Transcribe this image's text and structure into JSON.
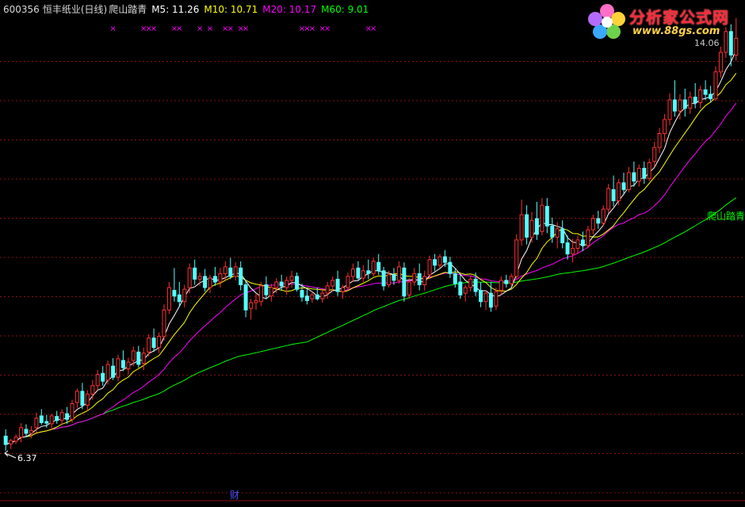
{
  "header": {
    "code": "600356",
    "name": "恒丰纸业(日线)",
    "indicator": "爬山踏青",
    "ma5": "M5: 11.26",
    "ma10": "M10: 10.71",
    "ma20": "M20: 10.17",
    "ma60": "M60: 9.01"
  },
  "watermark": {
    "title": "分析家公式网",
    "url": "www.88gs.com"
  },
  "colors": {
    "up": "#ff3030",
    "down": "#54ffff",
    "ma5": "#ffffff",
    "ma10": "#ffff00",
    "ma20": "#ff00ff",
    "ma60": "#00ff00",
    "grid": "#8a1010",
    "marker": "#ff00ff",
    "bottom_label": "#5050ff"
  },
  "chart_data": {
    "type": "candlestick",
    "title": "",
    "xlabel": "",
    "ylabel": "",
    "ylim": [
      5.9,
      14.1
    ],
    "grid": true,
    "low_label": "6.37",
    "high_label": "14.06",
    "series_label": "爬山踏青",
    "bottom_label": "财",
    "marker_symbol": "×",
    "marker_indices": [
      21,
      27,
      28,
      29,
      33,
      34,
      38,
      40,
      43,
      44,
      46,
      47,
      58,
      59,
      60,
      62,
      63,
      71,
      72
    ],
    "ohlc": [
      [
        6.6,
        6.72,
        6.34,
        6.45
      ],
      [
        6.46,
        6.55,
        6.37,
        6.52
      ],
      [
        6.51,
        6.63,
        6.46,
        6.58
      ],
      [
        6.58,
        6.83,
        6.49,
        6.75
      ],
      [
        6.72,
        6.81,
        6.58,
        6.65
      ],
      [
        6.65,
        6.78,
        6.56,
        6.7
      ],
      [
        6.75,
        7.02,
        6.66,
        6.92
      ],
      [
        6.96,
        7.08,
        6.8,
        6.84
      ],
      [
        6.86,
        6.98,
        6.75,
        6.83
      ],
      [
        6.82,
        7.0,
        6.72,
        6.96
      ],
      [
        6.95,
        7.05,
        6.82,
        6.88
      ],
      [
        6.88,
        7.08,
        6.8,
        7.02
      ],
      [
        7.0,
        7.12,
        6.82,
        6.9
      ],
      [
        6.9,
        7.25,
        6.84,
        7.18
      ],
      [
        7.2,
        7.45,
        7.1,
        7.4
      ],
      [
        7.4,
        7.55,
        7.08,
        7.15
      ],
      [
        7.15,
        7.42,
        7.05,
        7.35
      ],
      [
        7.35,
        7.6,
        7.25,
        7.5
      ],
      [
        7.5,
        7.78,
        7.42,
        7.7
      ],
      [
        7.72,
        7.85,
        7.5,
        7.58
      ],
      [
        7.6,
        7.95,
        7.52,
        7.88
      ],
      [
        7.85,
        7.99,
        7.6,
        7.65
      ],
      [
        7.65,
        8.05,
        7.58,
        7.98
      ],
      [
        7.95,
        8.13,
        7.76,
        7.82
      ],
      [
        7.8,
        8.0,
        7.7,
        7.92
      ],
      [
        7.95,
        8.2,
        7.85,
        8.12
      ],
      [
        8.1,
        8.21,
        7.82,
        7.88
      ],
      [
        7.9,
        8.18,
        7.78,
        8.08
      ],
      [
        8.1,
        8.42,
        8.02,
        8.35
      ],
      [
        8.35,
        8.52,
        8.1,
        8.18
      ],
      [
        8.18,
        8.45,
        8.08,
        8.38
      ],
      [
        8.38,
        8.95,
        8.3,
        8.85
      ],
      [
        8.85,
        9.35,
        8.78,
        9.25
      ],
      [
        9.2,
        9.6,
        9.0,
        9.1
      ],
      [
        9.12,
        9.35,
        8.9,
        9.0
      ],
      [
        9.0,
        9.3,
        8.9,
        9.22
      ],
      [
        9.25,
        9.68,
        9.15,
        9.6
      ],
      [
        9.6,
        9.75,
        9.3,
        9.4
      ],
      [
        9.4,
        9.52,
        9.28,
        9.45
      ],
      [
        9.45,
        9.58,
        9.18,
        9.25
      ],
      [
        9.25,
        9.48,
        9.15,
        9.42
      ],
      [
        9.45,
        9.62,
        9.28,
        9.35
      ],
      [
        9.35,
        9.6,
        9.25,
        9.5
      ],
      [
        9.5,
        9.72,
        9.38,
        9.62
      ],
      [
        9.6,
        9.78,
        9.4,
        9.45
      ],
      [
        9.45,
        9.7,
        9.38,
        9.62
      ],
      [
        9.6,
        9.72,
        9.2,
        9.3
      ],
      [
        9.3,
        9.38,
        8.72,
        8.85
      ],
      [
        8.88,
        9.05,
        8.68,
        8.98
      ],
      [
        8.98,
        9.15,
        8.85,
        9.02
      ],
      [
        9.0,
        9.35,
        8.92,
        9.28
      ],
      [
        9.3,
        9.45,
        9.05,
        9.12
      ],
      [
        9.1,
        9.32,
        9.0,
        9.25
      ],
      [
        9.25,
        9.42,
        9.15,
        9.35
      ],
      [
        9.35,
        9.48,
        9.2,
        9.28
      ],
      [
        9.25,
        9.45,
        9.12,
        9.38
      ],
      [
        9.38,
        9.55,
        9.25,
        9.45
      ],
      [
        9.45,
        9.52,
        9.18,
        9.22
      ],
      [
        9.2,
        9.32,
        9.0,
        9.08
      ],
      [
        9.1,
        9.22,
        8.95,
        9.02
      ],
      [
        9.05,
        9.18,
        8.98,
        9.12
      ],
      [
        9.12,
        9.25,
        9.02,
        9.05
      ],
      [
        9.05,
        9.2,
        8.98,
        9.15
      ],
      [
        9.15,
        9.35,
        9.05,
        9.28
      ],
      [
        9.28,
        9.45,
        9.18,
        9.38
      ],
      [
        9.4,
        9.55,
        9.1,
        9.18
      ],
      [
        9.18,
        9.3,
        9.05,
        9.25
      ],
      [
        9.25,
        9.52,
        9.2,
        9.45
      ],
      [
        9.45,
        9.68,
        9.35,
        9.58
      ],
      [
        9.6,
        9.72,
        9.38,
        9.42
      ],
      [
        9.42,
        9.65,
        9.35,
        9.55
      ],
      [
        9.55,
        9.75,
        9.4,
        9.5
      ],
      [
        9.5,
        9.78,
        9.45,
        9.72
      ],
      [
        9.7,
        9.85,
        9.48,
        9.55
      ],
      [
        9.55,
        9.62,
        9.2,
        9.28
      ],
      [
        9.3,
        9.55,
        9.25,
        9.48
      ],
      [
        9.48,
        9.6,
        9.3,
        9.38
      ],
      [
        9.38,
        9.72,
        9.32,
        9.62
      ],
      [
        9.6,
        9.7,
        9.0,
        9.1
      ],
      [
        9.12,
        9.42,
        9.05,
        9.35
      ],
      [
        9.35,
        9.6,
        9.28,
        9.5
      ],
      [
        9.5,
        9.68,
        9.2,
        9.3
      ],
      [
        9.3,
        9.55,
        9.2,
        9.45
      ],
      [
        9.48,
        9.82,
        9.4,
        9.75
      ],
      [
        9.75,
        9.85,
        9.55,
        9.65
      ],
      [
        9.65,
        9.85,
        9.6,
        9.8
      ],
      [
        9.8,
        9.92,
        9.62,
        9.7
      ],
      [
        9.7,
        9.8,
        9.42,
        9.5
      ],
      [
        9.5,
        9.58,
        9.25,
        9.32
      ],
      [
        9.35,
        9.48,
        9.05,
        9.12
      ],
      [
        9.15,
        9.3,
        9.0,
        9.25
      ],
      [
        9.25,
        9.45,
        9.18,
        9.4
      ],
      [
        9.4,
        9.52,
        9.1,
        9.18
      ],
      [
        9.2,
        9.35,
        8.9,
        9.0
      ],
      [
        9.0,
        9.2,
        8.85,
        9.15
      ],
      [
        9.15,
        9.35,
        8.82,
        8.9
      ],
      [
        8.92,
        9.25,
        8.85,
        9.18
      ],
      [
        9.2,
        9.45,
        9.12,
        9.38
      ],
      [
        9.38,
        9.48,
        9.25,
        9.32
      ],
      [
        9.32,
        9.5,
        9.28,
        9.45
      ],
      [
        9.45,
        10.2,
        9.4,
        10.1
      ],
      [
        10.1,
        10.82,
        10.0,
        10.55
      ],
      [
        10.55,
        10.72,
        10.02,
        10.15
      ],
      [
        10.15,
        10.6,
        10.05,
        10.45
      ],
      [
        10.48,
        10.78,
        10.1,
        10.2
      ],
      [
        10.25,
        10.85,
        10.18,
        10.72
      ],
      [
        10.7,
        10.85,
        10.22,
        10.35
      ],
      [
        10.35,
        10.5,
        10.05,
        10.15
      ],
      [
        10.15,
        10.42,
        9.95,
        10.3
      ],
      [
        10.3,
        10.45,
        9.95,
        10.05
      ],
      [
        10.05,
        10.18,
        9.75,
        9.85
      ],
      [
        9.85,
        10.12,
        9.7,
        9.95
      ],
      [
        9.95,
        10.18,
        9.85,
        10.1
      ],
      [
        10.1,
        10.25,
        9.9,
        10.0
      ],
      [
        10.0,
        10.35,
        9.95,
        10.28
      ],
      [
        10.28,
        10.55,
        10.2,
        10.48
      ],
      [
        10.48,
        10.62,
        10.3,
        10.4
      ],
      [
        10.4,
        10.72,
        10.35,
        10.65
      ],
      [
        10.65,
        11.1,
        10.58,
        11.02
      ],
      [
        11.0,
        11.25,
        10.7,
        10.8
      ],
      [
        10.8,
        11.18,
        10.72,
        11.12
      ],
      [
        11.12,
        11.3,
        10.9,
        11.0
      ],
      [
        11.0,
        11.4,
        10.95,
        11.3
      ],
      [
        11.3,
        11.5,
        11.05,
        11.15
      ],
      [
        11.15,
        11.45,
        11.05,
        11.38
      ],
      [
        11.38,
        11.5,
        11.1,
        11.2
      ],
      [
        11.2,
        11.55,
        11.15,
        11.48
      ],
      [
        11.5,
        11.85,
        11.4,
        11.75
      ],
      [
        11.75,
        12.1,
        11.65,
        12.0
      ],
      [
        12.0,
        12.35,
        11.85,
        12.25
      ],
      [
        12.25,
        12.72,
        12.15,
        12.6
      ],
      [
        12.6,
        12.95,
        12.3,
        12.4
      ],
      [
        12.4,
        12.7,
        12.25,
        12.6
      ],
      [
        12.6,
        12.8,
        12.3,
        12.45
      ],
      [
        12.45,
        12.75,
        12.35,
        12.65
      ],
      [
        12.65,
        12.9,
        12.45,
        12.55
      ],
      [
        12.55,
        12.85,
        12.45,
        12.78
      ],
      [
        12.78,
        12.95,
        12.6,
        12.7
      ],
      [
        12.7,
        12.85,
        12.55,
        12.62
      ],
      [
        12.62,
        13.2,
        12.58,
        13.1
      ],
      [
        13.1,
        13.55,
        13.0,
        13.45
      ],
      [
        13.45,
        13.9,
        13.35,
        13.82
      ],
      [
        13.82,
        13.95,
        13.2,
        13.4
      ],
      [
        13.4,
        14.06,
        13.3,
        13.7
      ]
    ],
    "ma_end_values": {
      "M5": 11.26,
      "M10": 10.71,
      "M20": 10.17,
      "M60": 9.01
    }
  }
}
